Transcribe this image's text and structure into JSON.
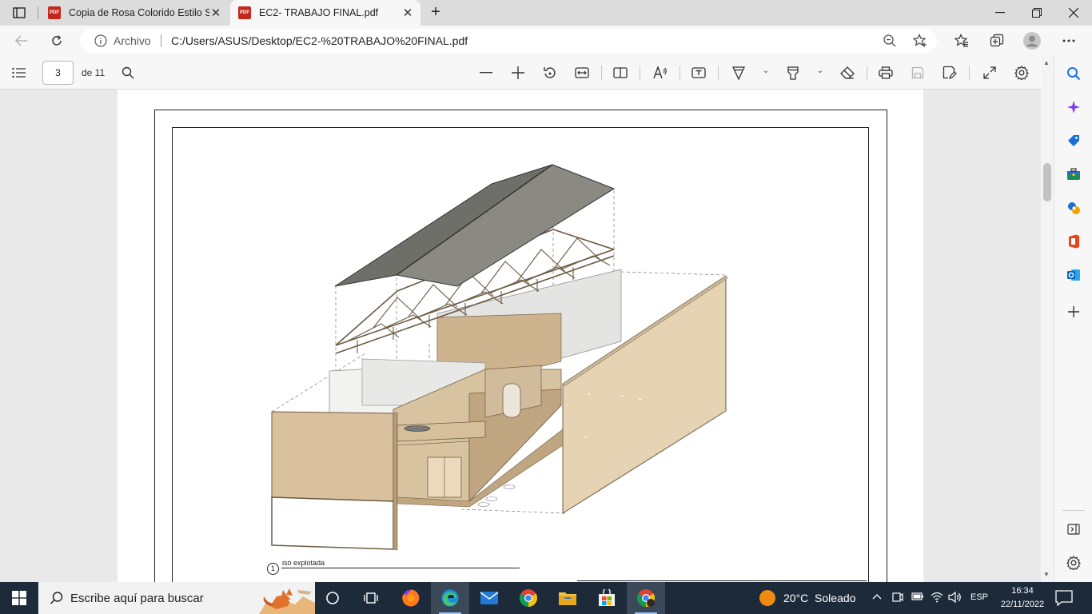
{
  "tabs": [
    {
      "title": "Copia de Rosa Colorido Estilo Se",
      "icon": "pdf-icon",
      "active": false
    },
    {
      "title": "EC2- TRABAJO FINAL.pdf",
      "icon": "pdf-icon",
      "active": true
    }
  ],
  "address_bar": {
    "security_label": "Archivo",
    "url": "C:/Users/ASUS/Desktop/EC2-%20TRABAJO%20FINAL.pdf"
  },
  "pdf_toolbar": {
    "current_page": "3",
    "page_total": "de 11"
  },
  "document": {
    "caption_number": "1",
    "caption_text": "iso explotada"
  },
  "taskbar": {
    "search_placeholder": "Escribe aquí para buscar",
    "weather": "20°C  Soleado",
    "language": "ESP",
    "time": "16:34",
    "date": "22/11/2022"
  },
  "colors": {
    "pdf_red": "#c4271d",
    "taskbar_bg": "#1c2a3a",
    "edge_blue": "#1a73e8"
  }
}
